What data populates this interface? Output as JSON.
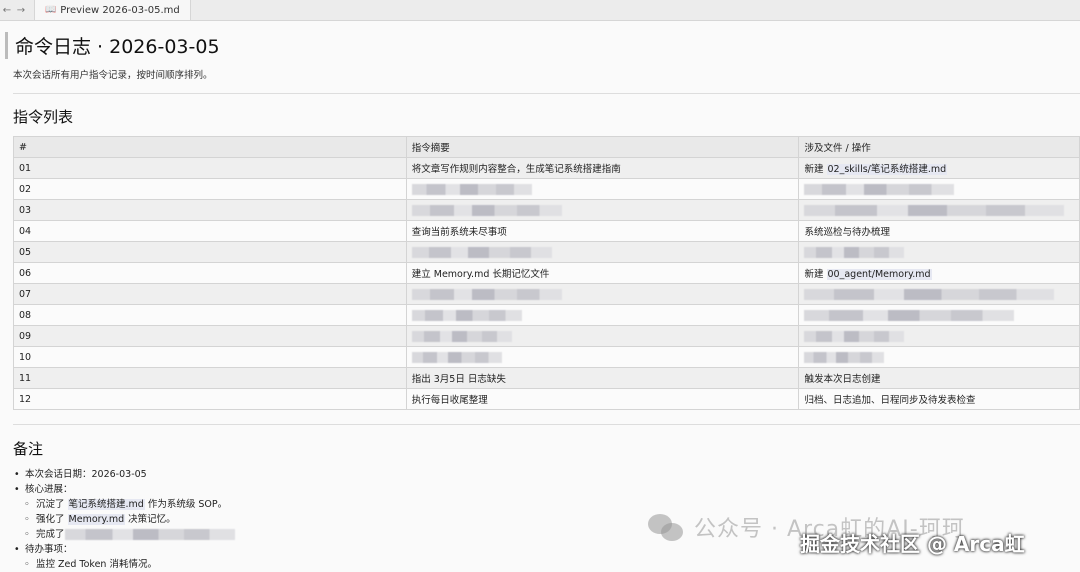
{
  "tabbar": {
    "back": "←",
    "forward": "→",
    "tab_icon": "book-icon",
    "tab_label": "Preview 2026-03-05.md"
  },
  "doc": {
    "title": "命令日志 · 2026-03-05",
    "subtitle": "本次会话所有用户指令记录，按时间顺序排列。",
    "section1": "指令列表",
    "section2": "备注"
  },
  "table": {
    "headers": [
      "#",
      "指令摘要",
      "涉及文件 / 操作"
    ],
    "rows": [
      {
        "n": "01",
        "summary": "将文章写作规则内容整合，生成笔记系统搭建指南",
        "op_prefix": "新建 ",
        "op_code": "02_skills/笔记系统搭建.md"
      },
      {
        "n": "02",
        "summary": "",
        "op": ""
      },
      {
        "n": "03",
        "summary": "",
        "op": ""
      },
      {
        "n": "04",
        "summary": "查询当前系统未尽事项",
        "op": "系统巡检与待办梳理"
      },
      {
        "n": "05",
        "summary": "",
        "op": ""
      },
      {
        "n": "06",
        "summary_prefix": "建立 ",
        "summary_code": "Memory.md",
        "summary_suffix": " 长期记忆文件",
        "op_prefix": "新建 ",
        "op_code": "00_agent/Memory.md"
      },
      {
        "n": "07",
        "summary": "",
        "op": ""
      },
      {
        "n": "08",
        "summary": "",
        "op": ""
      },
      {
        "n": "09",
        "summary": "",
        "op": ""
      },
      {
        "n": "10",
        "summary": "",
        "op": ""
      },
      {
        "n": "11",
        "summary": "指出 3月5日 日志缺失",
        "op": "触发本次日志创建"
      },
      {
        "n": "12",
        "summary": "执行每日收尾整理",
        "op": "归档、日志追加、日程同步及待发表检查"
      }
    ]
  },
  "notes": {
    "date": "本次会话日期：2026-03-05",
    "progress": "核心进展：",
    "p1_prefix": "沉淀了 ",
    "p1_code": "笔记系统搭建.md",
    "p1_suffix": " 作为系统级 SOP。",
    "p2_prefix": "强化了 ",
    "p2_code": "Memory.md",
    "p2_suffix": " 决策记忆。",
    "p3_prefix": "完成了",
    "todo": "待办事项：",
    "todo1": "监控 Zed Token 消耗情况。"
  },
  "watermark": {
    "line1": "公众号 · Arca虹的AI-珂珂",
    "line2": "掘金技术社区 @ Arca虹"
  }
}
